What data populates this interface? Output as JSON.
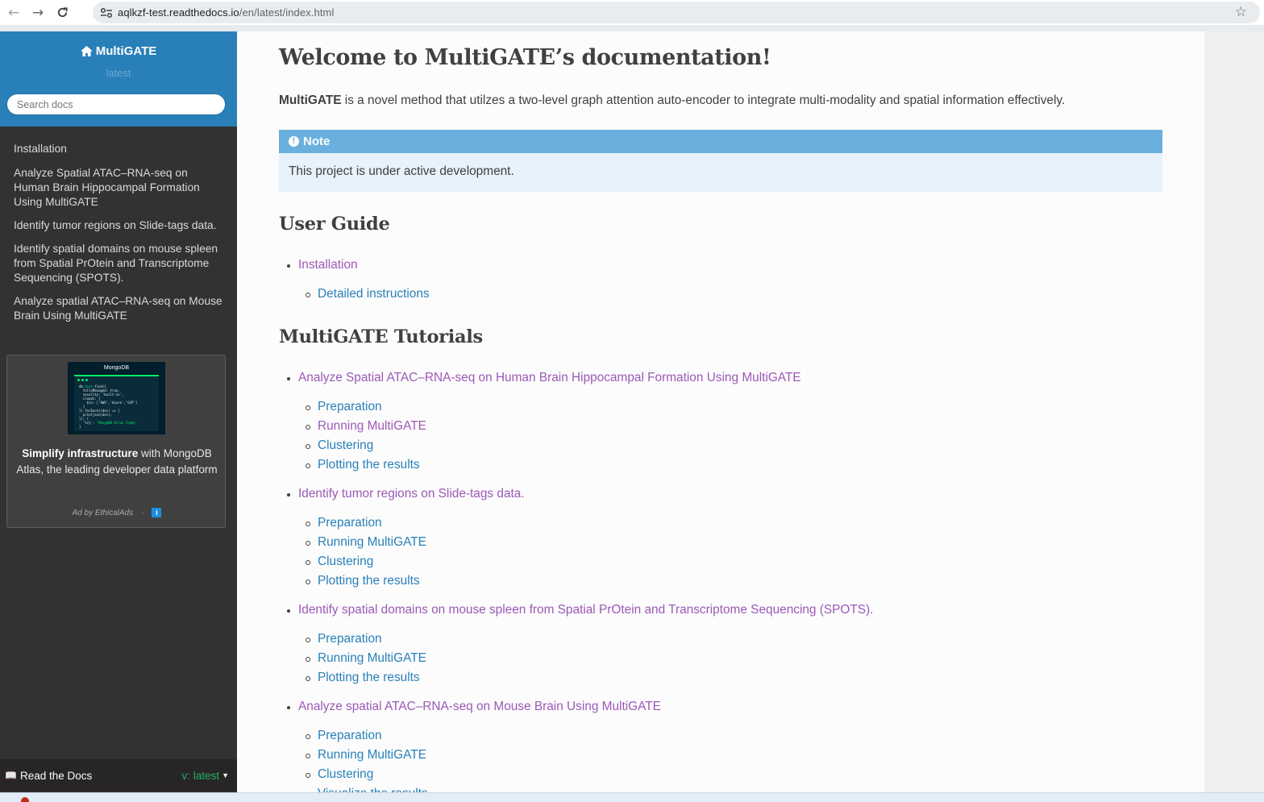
{
  "browser": {
    "url_host": "aqlkzf-test.readthedocs.io",
    "url_path": "/en/latest/index.html"
  },
  "sidebar": {
    "project": "MultiGATE",
    "version": "latest",
    "search_placeholder": "Search docs",
    "items": [
      "Installation",
      "Analyze Spatial ATAC–RNA-seq on Human Brain Hippocampal Formation Using MultiGATE",
      "Identify tumor regions on Slide-tags data.",
      "Identify spatial domains on mouse spleen from Spatial PrOtein and Transcriptome Sequencing (SPOTS).",
      "Analyze spatial ATAC–RNA-seq on Mouse Brain Using MultiGATE"
    ],
    "ad": {
      "image_brand": "MongoDB",
      "bold_text": "Simplify infrastructure",
      "text": " with MongoDB Atlas, the leading developer data platform",
      "footer": "Ad by EthicalAds",
      "separator": "·",
      "info": "i"
    },
    "footer": {
      "label": "Read the Docs",
      "version": "v: latest"
    }
  },
  "main": {
    "title": "Welcome to MultiGATE’s documentation!",
    "intro_bold": "MultiGATE",
    "intro_rest": " is a novel method that utilzes a two-level graph attention auto-encoder to integrate multi-modality and spatial information effectively.",
    "note": {
      "title": "Note",
      "body": "This project is under active development."
    },
    "user_guide": {
      "heading": "User Guide",
      "items": [
        {
          "label": "Installation",
          "subs": [
            "Detailed instructions"
          ]
        }
      ]
    },
    "tutorials": {
      "heading": "MultiGATE Tutorials",
      "items": [
        {
          "label": "Analyze Spatial ATAC–RNA-seq on Human Brain Hippocampal Formation Using MultiGATE",
          "subs": [
            "Preparation",
            "Running MultiGATE",
            "Clustering",
            "Plotting the results"
          ]
        },
        {
          "label": "Identify tumor regions on Slide-tags data.",
          "subs": [
            "Preparation",
            "Running MultiGATE",
            "Clustering",
            "Plotting the results"
          ]
        },
        {
          "label": "Identify spatial domains on mouse spleen from Spatial PrOtein and Transcriptome Sequencing (SPOTS).",
          "subs": [
            "Preparation",
            "Running MultiGATE",
            "Plotting the results"
          ]
        },
        {
          "label": "Analyze spatial ATAC–RNA-seq on Mouse Brain Using MultiGATE",
          "subs": [
            "Preparation",
            "Running MultiGATE",
            "Clustering",
            "Visualize the results"
          ]
        }
      ]
    }
  },
  "colors": {
    "sidebar_bg": "#343131",
    "header_blue": "#2980b9",
    "link": "#2980b9",
    "visited_link": "#9b59b6",
    "note_bg": "#e7f2fa",
    "note_title_bg": "#6ab0de"
  }
}
